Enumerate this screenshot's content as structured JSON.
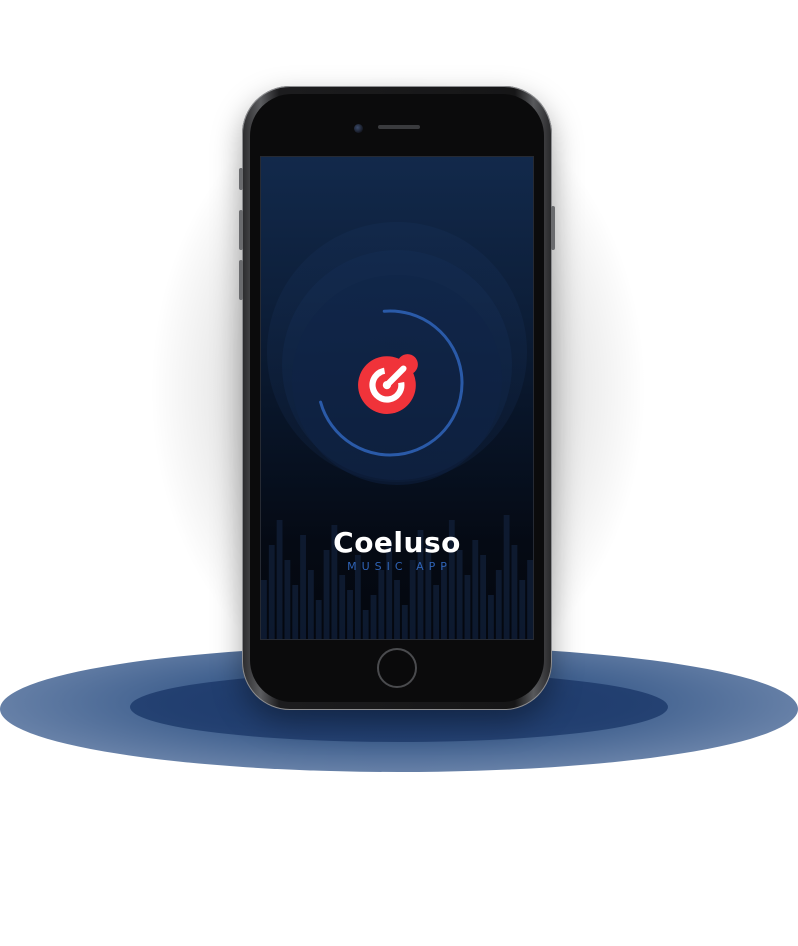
{
  "app": {
    "name": "Coeluso",
    "tagline": "MUSIC APP"
  },
  "loader": {
    "progress": 0.72
  },
  "colors": {
    "accent": "#f0333a",
    "ring": "#2a5aa8",
    "tagline": "#2f63b6",
    "background_top": "#12294b",
    "background_bottom": "#04070e"
  },
  "icons": {
    "logo": "coeluso-logo-icon",
    "camera": "camera-icon",
    "home": "home-button-icon"
  }
}
